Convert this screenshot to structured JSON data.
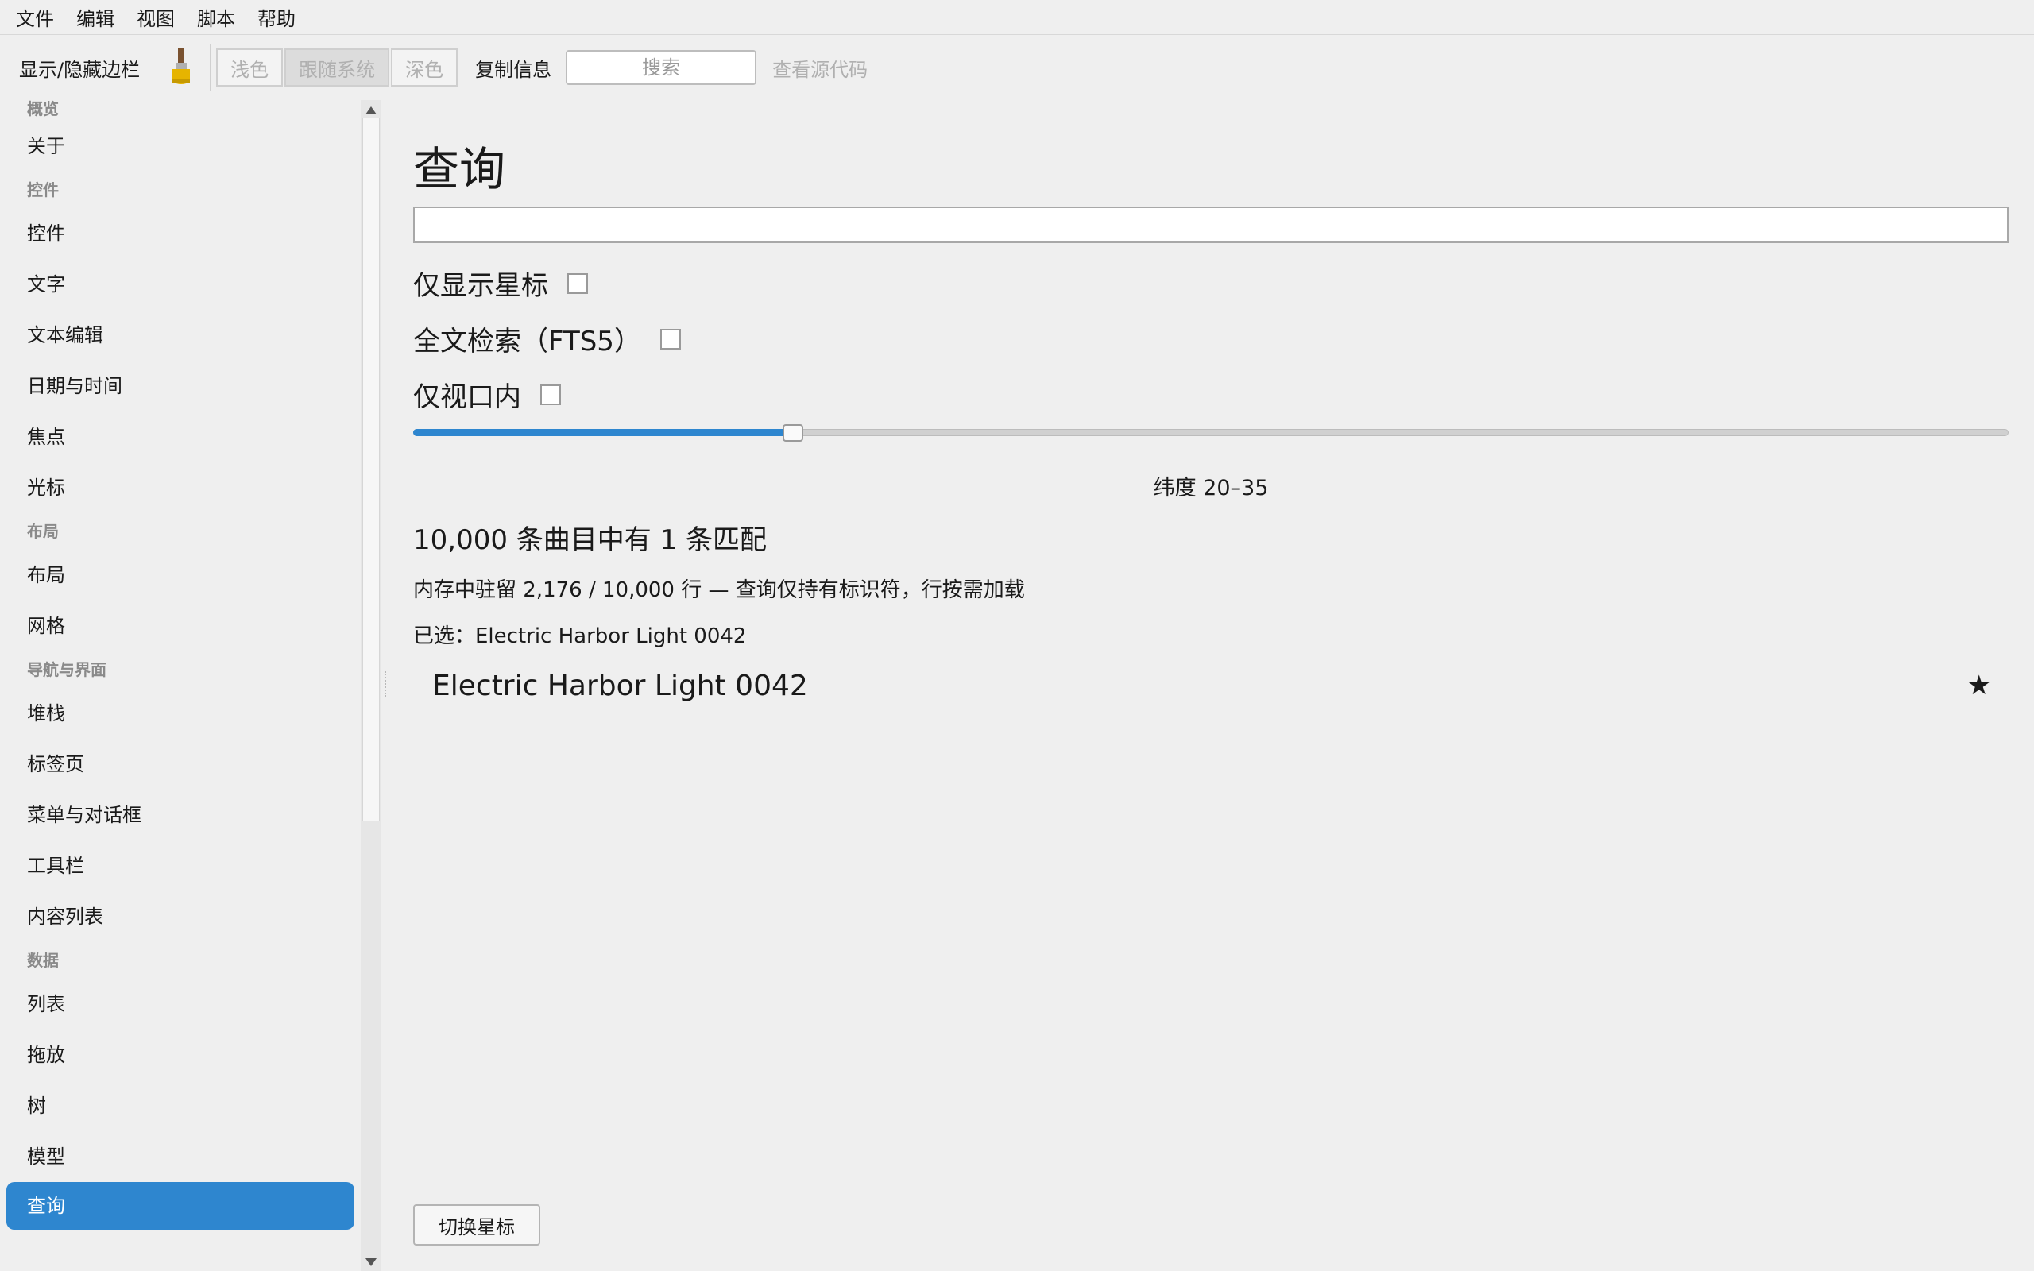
{
  "menu": [
    "文件",
    "编辑",
    "视图",
    "脚本",
    "帮助"
  ],
  "toolbar": {
    "toggle_sidebar": "显示/隐藏边栏",
    "brush_icon": "paintbrush-icon",
    "themes": [
      "浅色",
      "跟随系统",
      "深色"
    ],
    "active_theme": "跟随系统",
    "copy_info": "复制信息",
    "search_placeholder": "搜索",
    "view_source": "查看源代码"
  },
  "sidebar": {
    "groups": [
      {
        "title": "概览",
        "items": [
          "关于"
        ]
      },
      {
        "title": "控件",
        "items": [
          "控件",
          "文字",
          "文本编辑",
          "日期与时间",
          "焦点",
          "光标"
        ]
      },
      {
        "title": "布局",
        "items": [
          "布局",
          "网格"
        ]
      },
      {
        "title": "导航与界面",
        "items": [
          "堆栈",
          "标签页",
          "菜单与对话框",
          "工具栏",
          "内容列表"
        ]
      },
      {
        "title": "数据",
        "items": [
          "列表",
          "拖放",
          "树",
          "模型",
          "查询"
        ]
      }
    ],
    "active_item": "查询"
  },
  "main": {
    "title": "查询",
    "query_value": "",
    "options": [
      "仅显示星标",
      "全文检索（FTS5）",
      "仅视口内"
    ],
    "slider_value": 0.238,
    "latitude_label": "纬度 20–35",
    "match_count": "10,000 条曲目中有 1 条匹配",
    "memory_info": "内存中驻留 2,176 / 10,000 行 — 查询仅持有标识符，行按需加载",
    "selected": "已选：Electric Harbor Light 0042",
    "results": [
      {
        "title": "Electric Harbor Light 0042",
        "starred": true,
        "star_glyph": "★"
      }
    ],
    "toggle_star": "切换星标"
  },
  "colors": {
    "accent": "#2e86cf",
    "background": "#efefef"
  }
}
